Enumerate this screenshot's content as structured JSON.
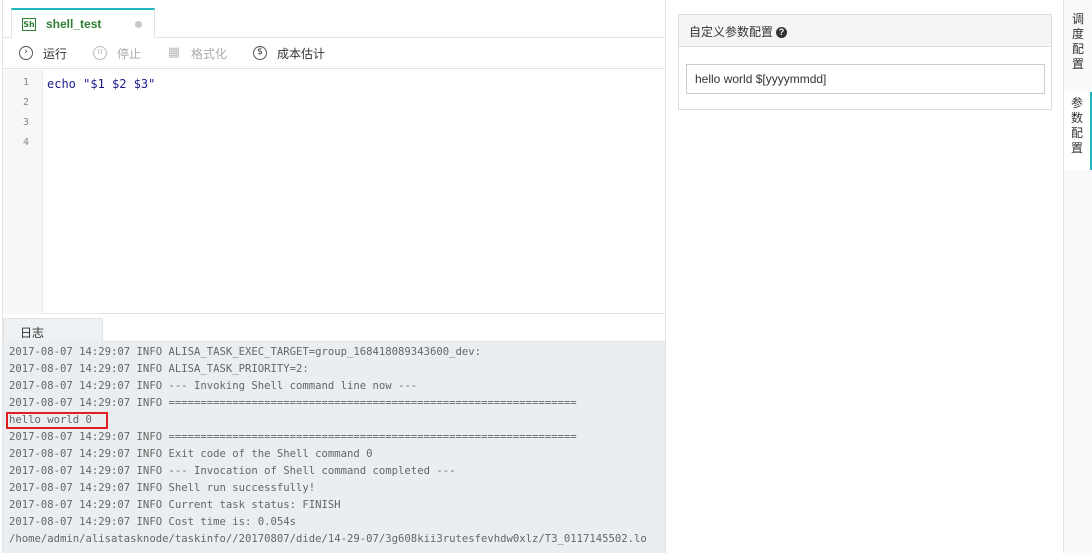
{
  "editor_tab": {
    "icon_text": "Sh",
    "name": "shell_test"
  },
  "toolbar": {
    "run_label": "运行",
    "stop_label": "停止",
    "format_label": "格式化",
    "cost_label": "成本估计"
  },
  "editor": {
    "line_numbers": [
      "1",
      "2",
      "3",
      "4"
    ],
    "code_line_1": "echo \"$1 $2 $3\""
  },
  "log_panel": {
    "tab_label": "日志",
    "lines": [
      "2017-08-07 14:29:07 INFO ALISA_TASK_EXEC_TARGET=group_168418089343600_dev:",
      "2017-08-07 14:29:07 INFO ALISA_TASK_PRIORITY=2:",
      "2017-08-07 14:29:07 INFO --- Invoking Shell command line now ---",
      "2017-08-07 14:29:07 INFO ================================================================",
      "hello world 0",
      "2017-08-07 14:29:07 INFO ================================================================",
      "2017-08-07 14:29:07 INFO Exit code of the Shell command 0",
      "2017-08-07 14:29:07 INFO --- Invocation of Shell command completed ---",
      "2017-08-07 14:29:07 INFO Shell run successfully!",
      "2017-08-07 14:29:07 INFO Current task status: FINISH",
      "2017-08-07 14:29:07 INFO Cost time is: 0.054s",
      "/home/admin/alisatasknode/taskinfo//20170807/dide/14-29-07/3g608kii3rutesfevhdw0xlz/T3_0117145502.lo"
    ]
  },
  "params_panel": {
    "title": "自定义参数配置",
    "help_icon_text": "?",
    "value": "hello world $[yyyymmdd]"
  },
  "side_tabs": [
    {
      "label_chars": [
        "调",
        "度",
        "配",
        "置"
      ]
    },
    {
      "label_chars": [
        "参",
        "数",
        "配",
        "置"
      ]
    }
  ],
  "colors": {
    "accent": "#1fb8c1",
    "shell_green": "#2e7d32",
    "highlight_red": "#e02020"
  }
}
